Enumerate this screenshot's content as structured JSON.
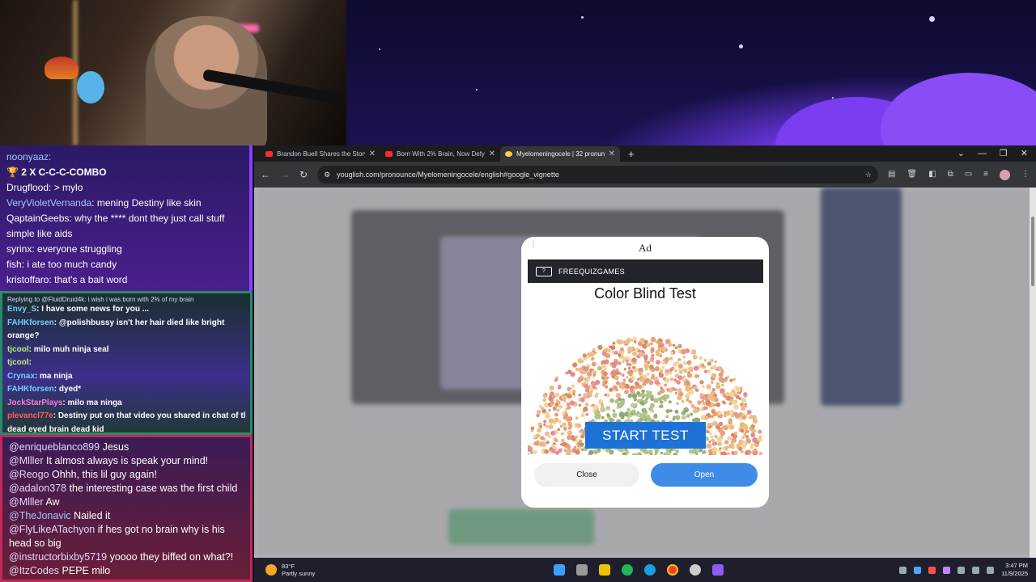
{
  "chat_top": [
    {
      "user": "noonyaaz",
      "text": "",
      "ucolor": "#a9c6ff"
    },
    {
      "user": "",
      "text": "2 X C-C-C-COMBO",
      "ucolor": "#ffffff"
    },
    {
      "user": "Drugflood",
      "text": "> mylo",
      "ucolor": "#ffffff"
    },
    {
      "user": "VeryVioletVernanda",
      "text": "mening Destiny like skin",
      "ucolor": "#a9c6ff"
    },
    {
      "user": "QaptainGeebs",
      "text": "why the **** dont they just call stuff",
      "ucolor": "#ffffff"
    },
    {
      "user": "",
      "text": "simple like aids",
      "ucolor": "#ffffff"
    },
    {
      "user": "syrinx",
      "text": "everyone struggling",
      "ucolor": "#ffffff"
    },
    {
      "user": "fish",
      "text": "i ate too much candy",
      "ucolor": "#ffffff"
    },
    {
      "user": "kristoffaro",
      "text": "that's a bait word",
      "ucolor": "#ffffff"
    }
  ],
  "chat_mid": {
    "reply": "Replying to @FluidDruid4k: i wish i was born with 2% of my brain",
    "messages": [
      {
        "user": "Envy_S",
        "text": "I have some news for you ...",
        "ucolor": "#6fd0ff"
      },
      {
        "user": "FAHKforsen",
        "text": "@polishbussy isn't her hair died like bright",
        "ucolor": "#6fd0ff"
      },
      {
        "user": "",
        "text": "orange?",
        "ucolor": "#ffffff"
      },
      {
        "user": "tjcool",
        "text": "milo muh ninja seal",
        "ucolor": "#b6f07d"
      },
      {
        "user": "tjcool",
        "text": "",
        "ucolor": "#b6f07d"
      },
      {
        "user": "Crynax",
        "text": "ma ninja",
        "ucolor": "#6fd0ff"
      },
      {
        "user": "FAHKforsen",
        "text": "dyed*",
        "ucolor": "#6fd0ff"
      },
      {
        "user": "JockStarPlays",
        "text": "milo ma ninga",
        "ucolor": "#ff7bd9"
      },
      {
        "user": "plevancl77e",
        "text": "Destiny put on that video you shared in chat of the t",
        "ucolor": "#ff5c5c"
      },
      {
        "user": "",
        "text": "dead eyed brain dead kid",
        "ucolor": "#ffffff"
      }
    ]
  },
  "chat_bottom": [
    {
      "user": "@enriqueblanco899",
      "text": "Jesus"
    },
    {
      "user": "@Mlller",
      "text": "It almost always is speak your mind!"
    },
    {
      "user": "@Reogo",
      "text": "Ohhh, this lil guy again!"
    },
    {
      "user": "@adalon378",
      "text": "the interesting case was the first child"
    },
    {
      "user": "@Mlller",
      "text": "Aw"
    },
    {
      "user": "@TheJonavic",
      "text": "Nailed it"
    },
    {
      "user": "@FlyLikeATachyon",
      "text": "if hes got no brain why is his head so big"
    },
    {
      "user": "@instructorbixby5719",
      "text": "yoooo they biffed on what?!"
    },
    {
      "user": "@ItzCodes",
      "text": "PEPE milo"
    }
  ],
  "browser": {
    "tabs": [
      {
        "title": "Brandon Buell Shares the Story",
        "favicon": "youtube",
        "active": false
      },
      {
        "title": "Born With 2% Brain, Now Defy",
        "favicon": "youtube",
        "active": false
      },
      {
        "title": "Myelomeningocele | 32 pronun",
        "favicon": "youglish",
        "active": true
      }
    ],
    "new_tab": "+",
    "url": "youglish.com/pronounce/Myelomeningocele/english#google_vignette"
  },
  "ad": {
    "label": "Ad",
    "brand": "FREEQUIZGAMES",
    "title": "Color Blind Test",
    "cta": "START TEST",
    "close": "Close",
    "open": "Open"
  },
  "taskbar": {
    "temp": "83°F",
    "weather": "Partly sunny",
    "time": "3:47 PM",
    "date": "11/9/2025"
  }
}
